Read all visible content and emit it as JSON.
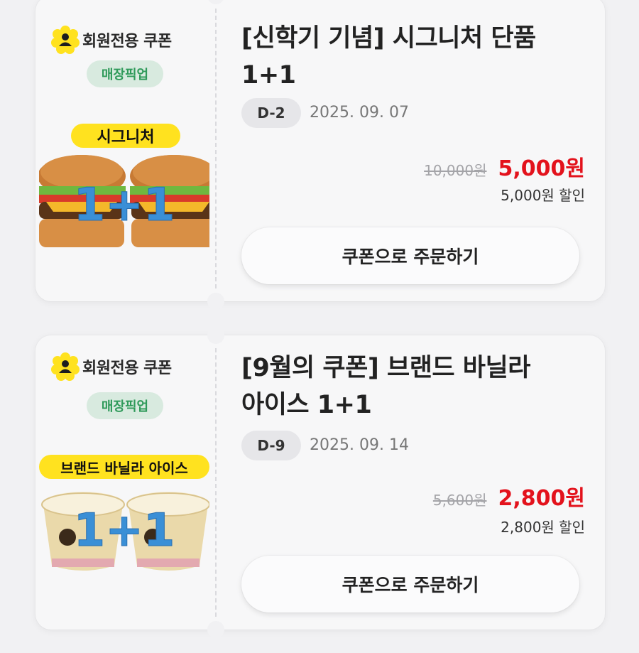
{
  "coupons": [
    {
      "member_label": "회원전용 쿠폰",
      "pickup_label": "매장픽업",
      "product_banner": "시그니처",
      "product_overlay": "1+1",
      "title_line1": "[신학기 기념] 시그니처 단품",
      "title_line2": "1+1",
      "dday": "D-2",
      "date": "2025. 09. 07",
      "original_price": "10,000원",
      "sale_price": "5,000원",
      "discount": "5,000원 할인",
      "order_button": "쿠폰으로 주문하기"
    },
    {
      "member_label": "회원전용 쿠폰",
      "pickup_label": "매장픽업",
      "product_banner": "브랜드 바닐라 아이스",
      "product_overlay": "1+1",
      "title_line1": "[9월의 쿠폰] 브랜드 바닐라",
      "title_line2": "아이스 1+1",
      "dday": "D-9",
      "date": "2025. 09. 14",
      "original_price": "5,600원",
      "sale_price": "2,800원",
      "discount": "2,800원 할인",
      "order_button": "쿠폰으로 주문하기"
    }
  ],
  "colors": {
    "sale_red": "#e3121c",
    "pickup_green": "#2f9a5a",
    "pickup_bg": "#d8eadf",
    "badge_yellow": "#ffe21f",
    "overlay_blue": "#3a8fd6"
  },
  "icons": {
    "member": "member-badge-icon"
  }
}
